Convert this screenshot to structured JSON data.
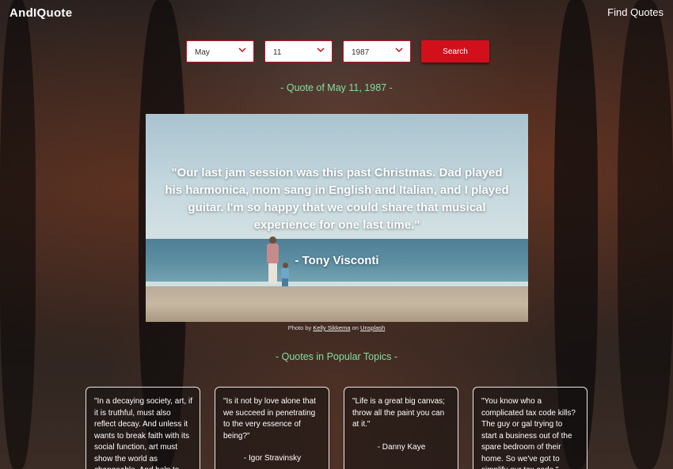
{
  "brand": "AndIQuote",
  "nav": {
    "find_quotes": "Find Quotes"
  },
  "search": {
    "month": "May",
    "day": "11",
    "year": "1987",
    "button_label": "Search"
  },
  "quote_of_day": {
    "heading": "- Quote of May 11, 1987 -",
    "text": "\"Our last jam session was this past Christmas. Dad played his harmonica, mom sang in English and Italian, and I played guitar. I'm so happy that we could share that musical experience for one last time.\"",
    "author": "- Tony Visconti",
    "credit_prefix": "Photo by",
    "credit_name": "Kelly Sikkema",
    "credit_mid": "on",
    "credit_site": "Unsplash"
  },
  "topics": {
    "heading": "- Quotes in Popular Topics -",
    "cards": [
      {
        "text": "\"In a decaying society, art, if it is truthful, must also reflect decay. And unless it wants to break faith with its social function, art must show the world as changeable. And help to",
        "author": ""
      },
      {
        "text": "\"Is it not by love alone that we succeed in penetrating to the very essence of being?\"",
        "author": "- Igor Stravinsky"
      },
      {
        "text": "\"Life is a great big canvas; throw all the paint you can at it.\"",
        "author": "- Danny Kaye"
      },
      {
        "text": "\"You know who a complicated tax code kills? The guy or gal trying to start a business out of the spare bedroom of their home. So we've got to simplify our tax code.\"",
        "author": ""
      }
    ]
  },
  "colors": {
    "accent": "#d1101c",
    "heading_green": "#7fe0a0"
  },
  "icons": {
    "select_chevron": "chevron-down-icon"
  }
}
